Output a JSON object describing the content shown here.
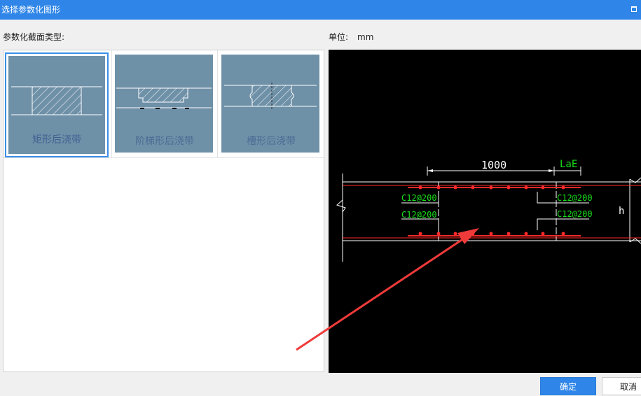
{
  "window": {
    "title": "选择参数化图形"
  },
  "section": {
    "type_label": "参数化截面类型:"
  },
  "unit": {
    "label": "单位:",
    "value": "mm"
  },
  "shapes": [
    {
      "label": "矩形后浇带",
      "selected": true
    },
    {
      "label": "阶梯形后浇带",
      "selected": false
    },
    {
      "label": "槽形后浇带",
      "selected": false
    }
  ],
  "drawing": {
    "dim_width": "1000",
    "lae": "LaE",
    "rebar_top_left": "C12@200",
    "rebar_bottom_left": "C12@200",
    "rebar_top_right": "C12@200",
    "rebar_bottom_right": "C12@200",
    "height_label": "h"
  },
  "buttons": {
    "ok": "确定",
    "cancel": "取消"
  },
  "colors": {
    "accent": "#2f86e8",
    "thumb_bg": "#6f91a8",
    "rebar_red": "#ff2a2a",
    "text_green": "#19e019"
  }
}
